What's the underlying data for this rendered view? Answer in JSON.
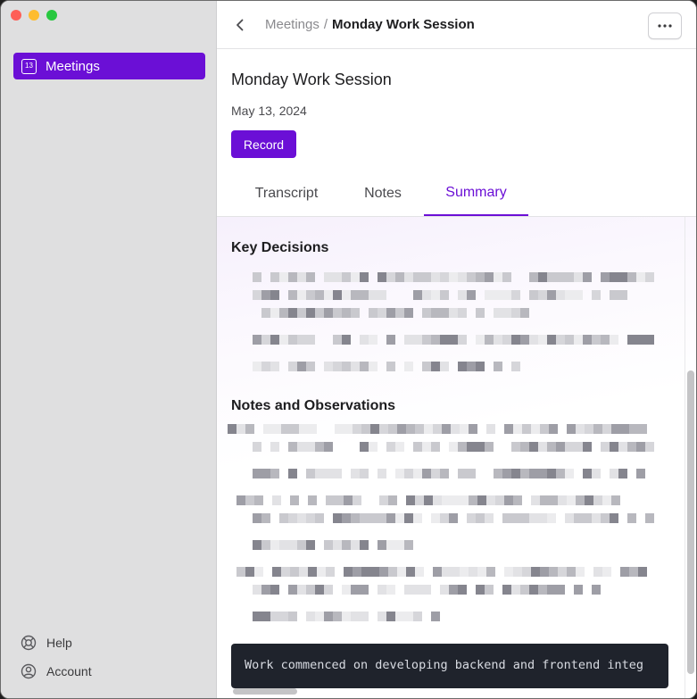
{
  "sidebar": {
    "nav": [
      {
        "label": "Meetings",
        "icon": "calendar-icon",
        "day": "13",
        "active": true
      }
    ],
    "bottom": [
      {
        "label": "Help",
        "icon": "lifebuoy-icon"
      },
      {
        "label": "Account",
        "icon": "account-icon"
      }
    ]
  },
  "topbar": {
    "breadcrumb_parent": "Meetings",
    "breadcrumb_sep": "/",
    "breadcrumb_current": "Monday Work Session"
  },
  "meeting": {
    "title": "Monday Work Session",
    "date": "May 13, 2024",
    "record_label": "Record"
  },
  "tabs": [
    {
      "label": "Transcript"
    },
    {
      "label": "Notes"
    },
    {
      "label": "Summary",
      "active": true
    }
  ],
  "summary": {
    "sections": [
      {
        "title": "Key Decisions"
      },
      {
        "title": "Notes and Observations"
      }
    ],
    "code_text": "Work commenced on developing backend and frontend integ"
  },
  "colors": {
    "accent": "#6b0fd6",
    "code_bg": "#1f232c"
  }
}
